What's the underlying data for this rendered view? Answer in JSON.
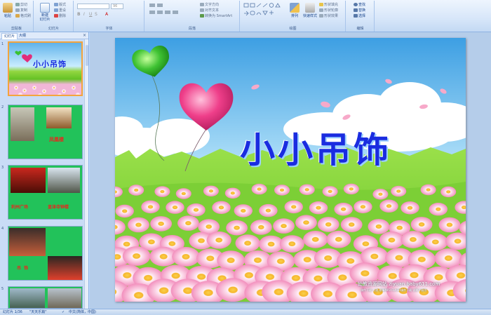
{
  "ribbon": {
    "clipboard": {
      "paste": "粘贴",
      "cut": "剪切",
      "copy": "复制",
      "format_painter": "格式刷",
      "label": "剪贴板"
    },
    "slides": {
      "new_slide": "新建\n幻灯片",
      "layout": "版式",
      "reset": "重设",
      "delete": "删除",
      "label": "幻灯片"
    },
    "font": {
      "size": "96",
      "label": "字体"
    },
    "paragraph": {
      "text_direction": "文字方向",
      "align_text": "对齐文本",
      "smartart": "转换为 SmartArt",
      "label": "段落"
    },
    "drawing": {
      "arrange": "排列",
      "quick_styles": "快速样式",
      "shape_fill": "形状填充",
      "shape_outline": "形状轮廓",
      "shape_effects": "形状效果",
      "label": "绘图"
    },
    "editing": {
      "find": "查找",
      "replace": "替换",
      "select": "选择",
      "label": "编辑"
    }
  },
  "pane": {
    "tabs": [
      "幻灯片",
      "大纲"
    ],
    "close": "×",
    "slides": [
      {
        "num": "1",
        "title": "小小吊饰"
      },
      {
        "num": "2",
        "caption": "凤凰楼"
      },
      {
        "num": "3",
        "caption_left": "利州广场",
        "caption_right": "皇泽寺钟楼"
      },
      {
        "num": "4",
        "caption": "吊  饰"
      },
      {
        "num": "5"
      }
    ]
  },
  "slide": {
    "title": "小小吊饰",
    "watermark_main": "幼教资源网站  ziyuan.baby611.com",
    "watermark_sub": "课件下载  儿歌  故事MP3  FLASH课件下载  试卷下载等"
  },
  "status": {
    "slide_count": "幻灯片 1/36",
    "theme": "\"天天乐篇\"",
    "language": "中文(简体，中国)"
  },
  "colors": {
    "title_blue": "#1a2ce0",
    "thumb_green": "#22c25a",
    "caption_red": "#e8271e"
  }
}
